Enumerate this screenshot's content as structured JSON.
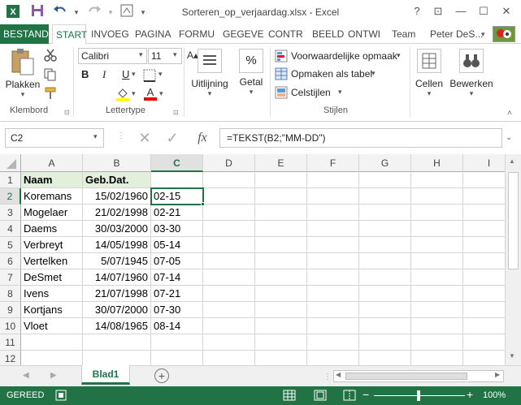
{
  "window": {
    "title": "Sorteren_op_verjaardag.xlsx - Excel",
    "help": "?",
    "restore": "⊡",
    "minimize": "—",
    "maximize": "☐",
    "close": "✕"
  },
  "quick_access": {
    "save_icon": "save-icon",
    "undo_icon": "undo-icon",
    "redo_icon": "redo-icon"
  },
  "tabs": {
    "file": "BESTAND",
    "items": [
      "START",
      "INVOEG",
      "PAGINA",
      "FORMU",
      "GEGEVE",
      "CONTR",
      "BEELD",
      "ONTWI",
      "Team"
    ],
    "user": "Peter DeS..."
  },
  "ribbon": {
    "paste_label": "Plakken",
    "clipboard_group": "Klembord",
    "font_name": "Calibri",
    "font_size": "11",
    "bold": "B",
    "italic": "I",
    "underline": "U",
    "font_group": "Lettertype",
    "alignment_label": "Uitlijning",
    "number_label": "Getal",
    "number_symbol": "%",
    "conditional_formatting": "Voorwaardelijke opmaak",
    "format_as_table": "Opmaken als tabel",
    "cell_styles": "Celstijlen",
    "styles_group": "Stijlen",
    "cells_label": "Cellen",
    "editing_label": "Bewerken"
  },
  "formula_bar": {
    "name_box": "C2",
    "fx": "fx",
    "formula": "=TEKST(B2;\"MM-DD\")"
  },
  "grid": {
    "columns": [
      "A",
      "B",
      "C",
      "D",
      "E",
      "F",
      "G",
      "H",
      "I"
    ],
    "selected_column": "C",
    "selected_row": "2",
    "row_numbers": [
      "1",
      "2",
      "3",
      "4",
      "5",
      "6",
      "7",
      "8",
      "9",
      "10",
      "11",
      "12"
    ],
    "header_row": {
      "a": "Naam",
      "b": "Geb.Dat."
    },
    "rows": [
      {
        "a": "Koremans",
        "b": "15/02/1960",
        "c": "02-15"
      },
      {
        "a": "Mogelaer",
        "b": "21/02/1998",
        "c": "02-21"
      },
      {
        "a": "Daems",
        "b": "30/03/2000",
        "c": "03-30"
      },
      {
        "a": "Verbreyt",
        "b": "14/05/1998",
        "c": "05-14"
      },
      {
        "a": "Vertelken",
        "b": "5/07/1945",
        "c": "07-05"
      },
      {
        "a": "DeSmet",
        "b": "14/07/1960",
        "c": "07-14"
      },
      {
        "a": "Ivens",
        "b": "21/07/1998",
        "c": "07-21"
      },
      {
        "a": "Kortjans",
        "b": "30/07/2000",
        "c": "07-30"
      },
      {
        "a": "Vloet",
        "b": "14/08/1965",
        "c": "08-14"
      }
    ]
  },
  "sheet_tabs": {
    "active": "Blad1",
    "add": "+"
  },
  "status_bar": {
    "ready": "GEREED",
    "zoom": "100%",
    "zoom_minus": "−",
    "zoom_plus": "+"
  },
  "colors": {
    "accent": "#217346",
    "header_fill": "#e2efda"
  }
}
